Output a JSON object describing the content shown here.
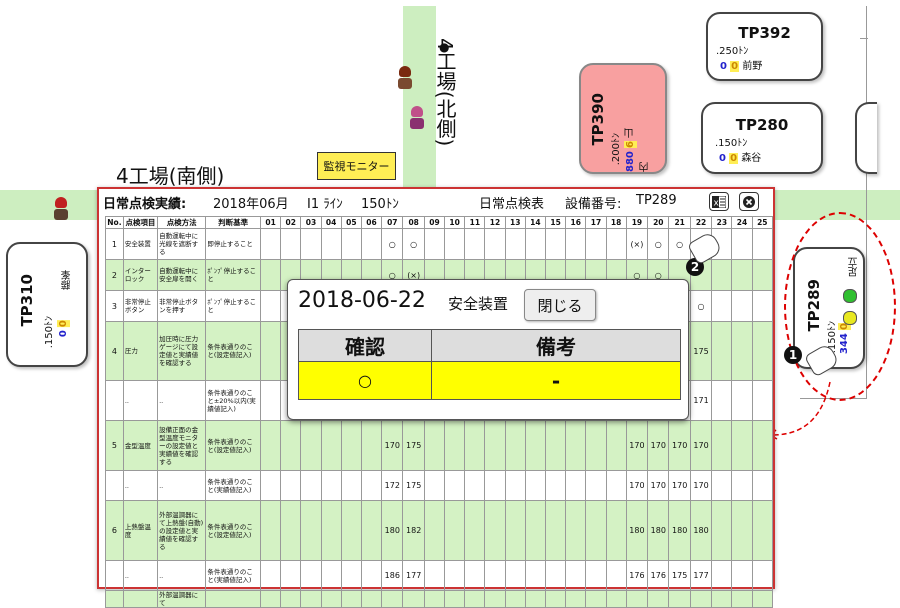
{
  "map": {
    "hall_south": "4工場(南側)",
    "hall_north": "4工場(北側)",
    "monitor_label": "監視モニター"
  },
  "machines": {
    "tp392": {
      "name": "TP392",
      "tonnage": ".250ﾄﾝ",
      "blue": "0",
      "orange": "0",
      "op": "前野"
    },
    "tp390": {
      "name": "TP390",
      "tonnage": ".200ﾄﾝ",
      "blue": "880",
      "orange": "6",
      "op": "山内"
    },
    "tp280": {
      "name": "TP280",
      "tonnage": ".150ﾄﾝ",
      "blue": "0",
      "orange": "0",
      "op": "森谷"
    },
    "tp289": {
      "name": "TP289",
      "tonnage": ".150ﾄﾝ",
      "blue": "344",
      "orange": "0",
      "op": "足立"
    },
    "tp310": {
      "name": "TP310",
      "tonnage": ".150ﾄﾝ",
      "blue": "0",
      "orange": "0",
      "op": "藤峯"
    }
  },
  "window": {
    "title": "日常点検実績:",
    "period": "2018年06月",
    "line": "I1 ﾗｲﾝ",
    "tonnage": "150ﾄﾝ",
    "sheet": "日常点検表",
    "equip_label": "設備番号:",
    "equip_no": "TP289",
    "excel_icon": "excel-icon",
    "close_icon": "close-icon",
    "headers": [
      "No.",
      "点検項目",
      "点検方法",
      "判断基準"
    ],
    "days": [
      "01",
      "02",
      "03",
      "04",
      "05",
      "06",
      "07",
      "08",
      "09",
      "10",
      "11",
      "12",
      "13",
      "14",
      "15",
      "16",
      "17",
      "18",
      "19",
      "20",
      "21",
      "22",
      "23",
      "24",
      "25"
    ],
    "rows": [
      {
        "no": "1",
        "item": "安全装置",
        "method": "自動運転中に光線を遮断する",
        "criteria": "即停止すること",
        "green": false,
        "vals": {
          "07": "○",
          "08": "○",
          "19": "(×)",
          "20": "○",
          "21": "○"
        }
      },
      {
        "no": "2",
        "item": "インターロック",
        "method": "自動運転中に安全扉を開く",
        "criteria": "ﾎﾟﾝﾌﾟ停止すること",
        "green": true,
        "vals": {
          "07": "○",
          "08": "(×)",
          "19": "○",
          "20": "○"
        }
      },
      {
        "no": "3",
        "item": "非常停止ボタン",
        "method": "非常停止ボタンを押す",
        "criteria": "ﾎﾟﾝﾌﾟ停止すること",
        "green": false,
        "vals": {
          "22": "○"
        }
      },
      {
        "no": "4",
        "item": "圧力",
        "method": "加圧時に圧力ゲージにて設定値と実績値を確認する",
        "criteria": "条件表通りのこと(設定値記入)",
        "green": true,
        "vals": {
          "22": "175"
        }
      },
      {
        "no": "",
        "item": "..",
        "method": "..",
        "criteria": "条件表通りのこと±20%以内(実績値記入)",
        "green": false,
        "vals": {
          "22": "171"
        }
      },
      {
        "no": "5",
        "item": "金型温度",
        "method": "設備正面の金型温度モニターの設定値と実績値を確認する",
        "criteria": "条件表通りのこと(設定値記入)",
        "green": true,
        "vals": {
          "07": "170",
          "08": "175",
          "19": "170",
          "20": "170",
          "21": "170",
          "22": "170"
        }
      },
      {
        "no": "",
        "item": "..",
        "method": "..",
        "criteria": "条件表通りのこと(実績値記入)",
        "green": false,
        "vals": {
          "07": "172",
          "08": "175",
          "19": "170",
          "20": "170",
          "21": "170",
          "22": "170"
        }
      },
      {
        "no": "6",
        "item": "上熱盤温度",
        "method": "外部温調器にて上熱盤(自動)の設定値と実績値を確認する",
        "criteria": "条件表通りのこと(設定値記入)",
        "green": true,
        "vals": {
          "07": "180",
          "08": "182",
          "19": "180",
          "20": "180",
          "21": "180",
          "22": "180"
        }
      },
      {
        "no": "",
        "item": "..",
        "method": "..",
        "criteria": "条件表通りのこと(実績値記入)",
        "green": false,
        "vals": {
          "07": "186",
          "08": "177",
          "19": "176",
          "20": "176",
          "21": "175",
          "22": "177"
        }
      },
      {
        "no": "",
        "item": "",
        "method": "外部温調器にて",
        "criteria": "",
        "green": true,
        "vals": {}
      }
    ]
  },
  "popup": {
    "date": "2018-06-22",
    "category": "安全装置",
    "close_label": "閉じる",
    "col_confirm": "確認",
    "col_remarks": "備考",
    "confirm_value": "○",
    "remarks_value": "-"
  },
  "badges": {
    "one": "❶",
    "two": "❷"
  },
  "colors": {
    "accent_red": "#cc3333",
    "highlight_yellow": "#ffff00",
    "row_green": "#d4f2c4",
    "tp390_bg": "#f8a0a0"
  }
}
